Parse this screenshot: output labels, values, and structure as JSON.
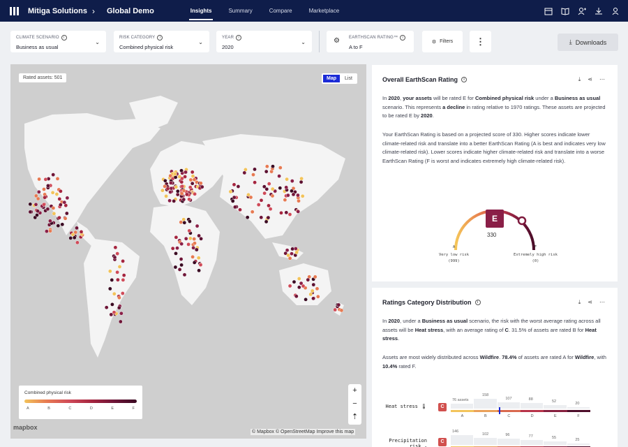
{
  "header": {
    "org": "Mitiga Solutions",
    "project": "Global Demo",
    "tabs": [
      {
        "label": "Insights",
        "active": true
      },
      {
        "label": "Summary",
        "active": false
      },
      {
        "label": "Compare",
        "active": false
      },
      {
        "label": "Marketplace",
        "active": false
      }
    ],
    "icons": [
      "calendar-icon",
      "book-icon",
      "add-user-icon",
      "download-icon",
      "user-icon"
    ]
  },
  "filters": {
    "climate_scenario": {
      "label": "CLIMATE SCENARIO",
      "value": "Business as usual"
    },
    "risk_category": {
      "label": "RISK CATEGORY",
      "value": "Combined physical risk"
    },
    "year": {
      "label": "YEAR",
      "value": "2020"
    },
    "earthscan_rating": {
      "label": "EARTHSCAN RATING™",
      "value": "A to F"
    },
    "filters_label": "Filters",
    "downloads_label": "Downloads"
  },
  "map": {
    "rated_assets": "Rated assets: 501",
    "toggle": {
      "map": "Map",
      "list": "List"
    },
    "legend": {
      "title": "Combined physical risk",
      "grades": [
        "A",
        "B",
        "C",
        "D",
        "E",
        "F"
      ]
    },
    "zoom": {
      "in": "+",
      "out": "−"
    },
    "mapbox_logo": "mapbox",
    "attribution": "© Mapbox © OpenStreetMap Improve this map"
  },
  "overall": {
    "title": "Overall EarthScan Rating",
    "para1_parts": [
      "In ",
      "2020",
      ", ",
      "your assets",
      " will be rated E for ",
      "Combined physical risk",
      " under a ",
      "Business as usual",
      " scenario. This represents ",
      "a decline",
      " in rating relative to 1970 ratings. These assets are projected to be rated E by ",
      "2020",
      "."
    ],
    "para2": "Your EarthScan Rating is based on a projected score of 330. Higher scores indicate lower climate-related risk and translate into a better EarthScan Rating (A is best and indicates very low climate-related risk). Lower scores indicate higher climate-related risk and translate into a worse EarthScan Rating (F is worst and indicates extremely high climate-related risk).",
    "grade": "E",
    "score": "330",
    "low_grade": "A",
    "low_label": "Very low risk",
    "low_score": "(999)",
    "high_grade": "F",
    "high_label": "Extremely high risk",
    "high_score": "(0)"
  },
  "distribution": {
    "title": "Ratings Category Distribution",
    "para1_parts": [
      "In ",
      "2020",
      ", under a ",
      "Business as usual",
      " scenario, the risk with the worst average rating across all assets will be ",
      "Heat stress",
      ", with an average rating of ",
      "C",
      ". 31.5% of assets are rated B for ",
      "Heat stress",
      "."
    ],
    "para2_parts": [
      "Assets are most widely distributed across ",
      "Wildfire",
      ". ",
      "78.4%",
      " of assets are rated A for ",
      "Wildfire",
      ", with ",
      "10.4%",
      " rated F."
    ],
    "rows": [
      {
        "label": "Heat stress",
        "grade": "C",
        "counts": [
          "76 assets",
          "158",
          "107",
          "88",
          "52",
          "20"
        ],
        "values": [
          76,
          158,
          107,
          88,
          52,
          20
        ],
        "grades": [
          "A",
          "B",
          "C",
          "D",
          "E",
          "F"
        ]
      },
      {
        "label": "Precipitation risk",
        "grade": "C",
        "counts": [
          "146",
          "102",
          "96",
          "77",
          "55",
          "25"
        ],
        "values": [
          146,
          102,
          96,
          77,
          55,
          25
        ],
        "grades": [
          "A",
          "B",
          "C",
          "D",
          "E",
          "F"
        ]
      }
    ]
  },
  "colors": {
    "nav": "#0f1d4a",
    "grade_e": "#8a1f47",
    "grade_c": "#d1504e",
    "toggle_active": "#1b2bd6"
  }
}
